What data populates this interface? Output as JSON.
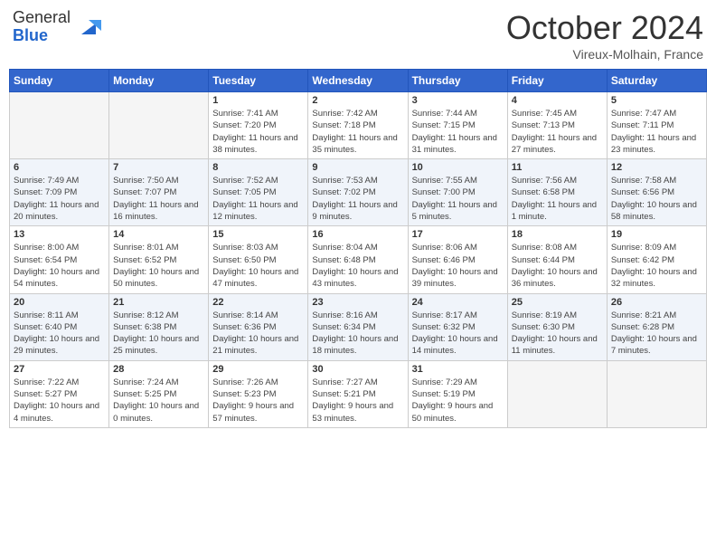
{
  "header": {
    "logo": {
      "general": "General",
      "blue": "Blue"
    },
    "title": "October 2024",
    "location": "Vireux-Molhain, France"
  },
  "weekdays": [
    "Sunday",
    "Monday",
    "Tuesday",
    "Wednesday",
    "Thursday",
    "Friday",
    "Saturday"
  ],
  "weeks": [
    [
      {
        "day": null
      },
      {
        "day": null
      },
      {
        "day": "1",
        "sunrise": "Sunrise: 7:41 AM",
        "sunset": "Sunset: 7:20 PM",
        "daylight": "Daylight: 11 hours and 38 minutes."
      },
      {
        "day": "2",
        "sunrise": "Sunrise: 7:42 AM",
        "sunset": "Sunset: 7:18 PM",
        "daylight": "Daylight: 11 hours and 35 minutes."
      },
      {
        "day": "3",
        "sunrise": "Sunrise: 7:44 AM",
        "sunset": "Sunset: 7:15 PM",
        "daylight": "Daylight: 11 hours and 31 minutes."
      },
      {
        "day": "4",
        "sunrise": "Sunrise: 7:45 AM",
        "sunset": "Sunset: 7:13 PM",
        "daylight": "Daylight: 11 hours and 27 minutes."
      },
      {
        "day": "5",
        "sunrise": "Sunrise: 7:47 AM",
        "sunset": "Sunset: 7:11 PM",
        "daylight": "Daylight: 11 hours and 23 minutes."
      }
    ],
    [
      {
        "day": "6",
        "sunrise": "Sunrise: 7:49 AM",
        "sunset": "Sunset: 7:09 PM",
        "daylight": "Daylight: 11 hours and 20 minutes."
      },
      {
        "day": "7",
        "sunrise": "Sunrise: 7:50 AM",
        "sunset": "Sunset: 7:07 PM",
        "daylight": "Daylight: 11 hours and 16 minutes."
      },
      {
        "day": "8",
        "sunrise": "Sunrise: 7:52 AM",
        "sunset": "Sunset: 7:05 PM",
        "daylight": "Daylight: 11 hours and 12 minutes."
      },
      {
        "day": "9",
        "sunrise": "Sunrise: 7:53 AM",
        "sunset": "Sunset: 7:02 PM",
        "daylight": "Daylight: 11 hours and 9 minutes."
      },
      {
        "day": "10",
        "sunrise": "Sunrise: 7:55 AM",
        "sunset": "Sunset: 7:00 PM",
        "daylight": "Daylight: 11 hours and 5 minutes."
      },
      {
        "day": "11",
        "sunrise": "Sunrise: 7:56 AM",
        "sunset": "Sunset: 6:58 PM",
        "daylight": "Daylight: 11 hours and 1 minute."
      },
      {
        "day": "12",
        "sunrise": "Sunrise: 7:58 AM",
        "sunset": "Sunset: 6:56 PM",
        "daylight": "Daylight: 10 hours and 58 minutes."
      }
    ],
    [
      {
        "day": "13",
        "sunrise": "Sunrise: 8:00 AM",
        "sunset": "Sunset: 6:54 PM",
        "daylight": "Daylight: 10 hours and 54 minutes."
      },
      {
        "day": "14",
        "sunrise": "Sunrise: 8:01 AM",
        "sunset": "Sunset: 6:52 PM",
        "daylight": "Daylight: 10 hours and 50 minutes."
      },
      {
        "day": "15",
        "sunrise": "Sunrise: 8:03 AM",
        "sunset": "Sunset: 6:50 PM",
        "daylight": "Daylight: 10 hours and 47 minutes."
      },
      {
        "day": "16",
        "sunrise": "Sunrise: 8:04 AM",
        "sunset": "Sunset: 6:48 PM",
        "daylight": "Daylight: 10 hours and 43 minutes."
      },
      {
        "day": "17",
        "sunrise": "Sunrise: 8:06 AM",
        "sunset": "Sunset: 6:46 PM",
        "daylight": "Daylight: 10 hours and 39 minutes."
      },
      {
        "day": "18",
        "sunrise": "Sunrise: 8:08 AM",
        "sunset": "Sunset: 6:44 PM",
        "daylight": "Daylight: 10 hours and 36 minutes."
      },
      {
        "day": "19",
        "sunrise": "Sunrise: 8:09 AM",
        "sunset": "Sunset: 6:42 PM",
        "daylight": "Daylight: 10 hours and 32 minutes."
      }
    ],
    [
      {
        "day": "20",
        "sunrise": "Sunrise: 8:11 AM",
        "sunset": "Sunset: 6:40 PM",
        "daylight": "Daylight: 10 hours and 29 minutes."
      },
      {
        "day": "21",
        "sunrise": "Sunrise: 8:12 AM",
        "sunset": "Sunset: 6:38 PM",
        "daylight": "Daylight: 10 hours and 25 minutes."
      },
      {
        "day": "22",
        "sunrise": "Sunrise: 8:14 AM",
        "sunset": "Sunset: 6:36 PM",
        "daylight": "Daylight: 10 hours and 21 minutes."
      },
      {
        "day": "23",
        "sunrise": "Sunrise: 8:16 AM",
        "sunset": "Sunset: 6:34 PM",
        "daylight": "Daylight: 10 hours and 18 minutes."
      },
      {
        "day": "24",
        "sunrise": "Sunrise: 8:17 AM",
        "sunset": "Sunset: 6:32 PM",
        "daylight": "Daylight: 10 hours and 14 minutes."
      },
      {
        "day": "25",
        "sunrise": "Sunrise: 8:19 AM",
        "sunset": "Sunset: 6:30 PM",
        "daylight": "Daylight: 10 hours and 11 minutes."
      },
      {
        "day": "26",
        "sunrise": "Sunrise: 8:21 AM",
        "sunset": "Sunset: 6:28 PM",
        "daylight": "Daylight: 10 hours and 7 minutes."
      }
    ],
    [
      {
        "day": "27",
        "sunrise": "Sunrise: 7:22 AM",
        "sunset": "Sunset: 5:27 PM",
        "daylight": "Daylight: 10 hours and 4 minutes."
      },
      {
        "day": "28",
        "sunrise": "Sunrise: 7:24 AM",
        "sunset": "Sunset: 5:25 PM",
        "daylight": "Daylight: 10 hours and 0 minutes."
      },
      {
        "day": "29",
        "sunrise": "Sunrise: 7:26 AM",
        "sunset": "Sunset: 5:23 PM",
        "daylight": "Daylight: 9 hours and 57 minutes."
      },
      {
        "day": "30",
        "sunrise": "Sunrise: 7:27 AM",
        "sunset": "Sunset: 5:21 PM",
        "daylight": "Daylight: 9 hours and 53 minutes."
      },
      {
        "day": "31",
        "sunrise": "Sunrise: 7:29 AM",
        "sunset": "Sunset: 5:19 PM",
        "daylight": "Daylight: 9 hours and 50 minutes."
      },
      {
        "day": null
      },
      {
        "day": null
      }
    ]
  ]
}
